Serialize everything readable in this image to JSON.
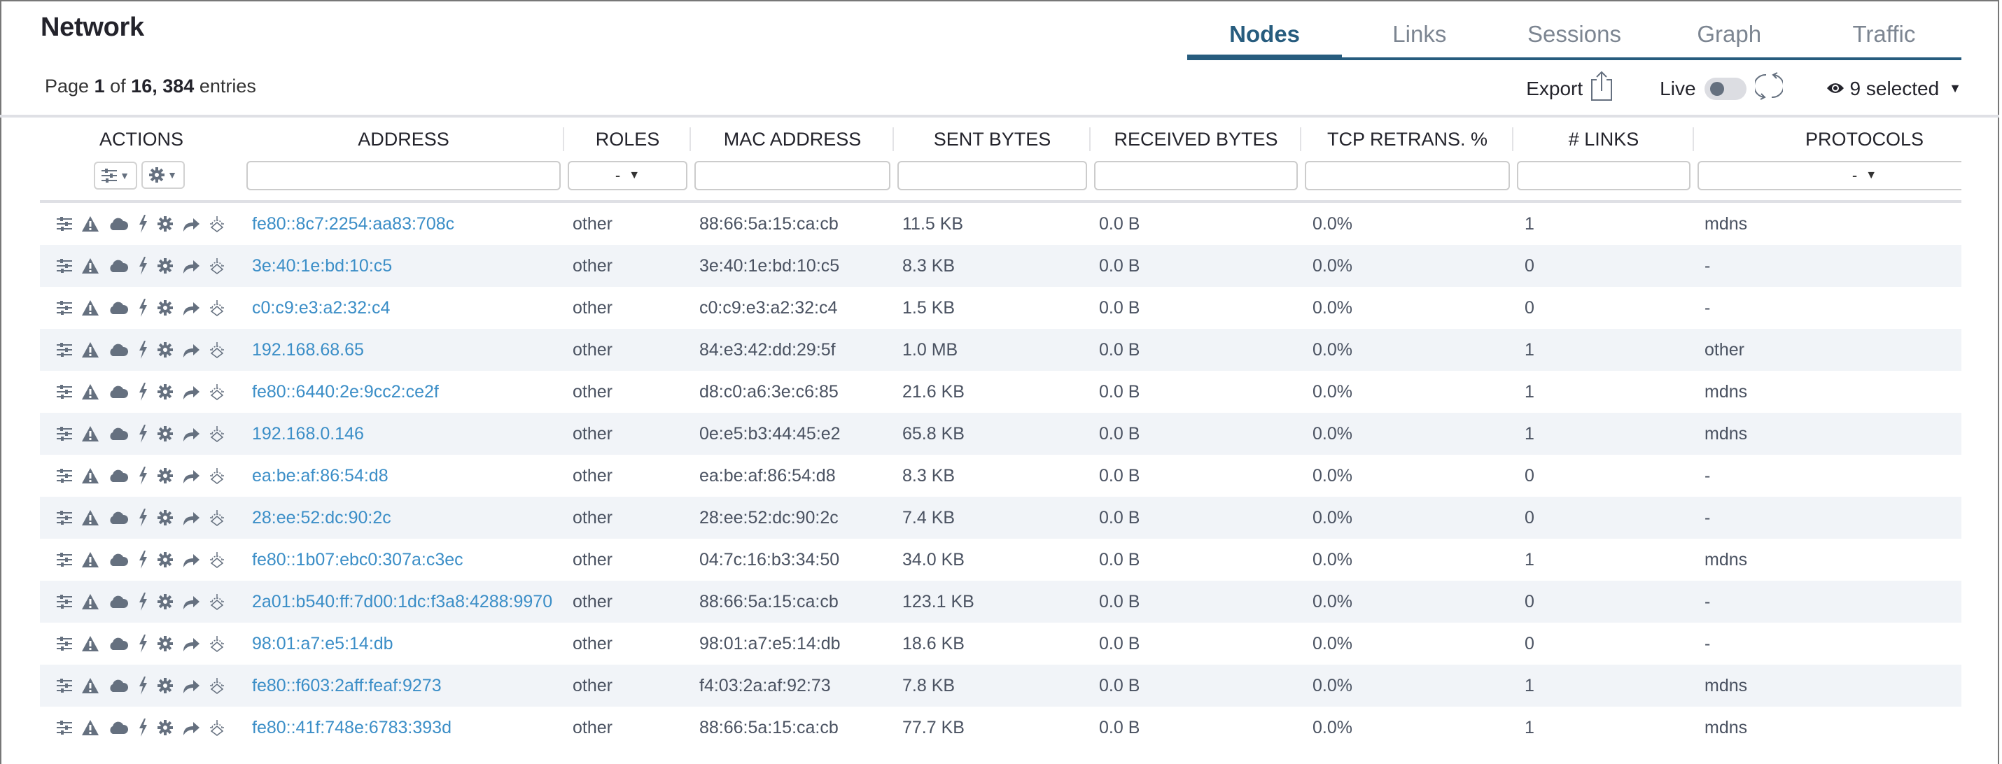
{
  "page": {
    "title": "Network",
    "pagination": {
      "prefix": "Page",
      "current": "1",
      "of_label": "of",
      "pages": "16",
      "count": "384",
      "suffix": "entries"
    }
  },
  "tabs": [
    {
      "label": "Nodes",
      "active": true
    },
    {
      "label": "Links",
      "active": false
    },
    {
      "label": "Sessions",
      "active": false
    },
    {
      "label": "Graph",
      "active": false
    },
    {
      "label": "Traffic",
      "active": false
    }
  ],
  "toolbar": {
    "export_label": "Export",
    "live_label": "Live",
    "live_enabled": false,
    "columns_selected_label": "9 selected"
  },
  "table": {
    "columns": [
      "ACTIONS",
      "ADDRESS",
      "ROLES",
      "MAC ADDRESS",
      "SENT BYTES",
      "RECEIVED BYTES",
      "TCP RETRANS. %",
      "# LINKS",
      "PROTOCOLS"
    ],
    "filters": {
      "roles": "-",
      "protocols": "-"
    },
    "action_icons": [
      "sliders-icon",
      "warning-icon",
      "cloud-icon",
      "bolt-icon",
      "gear-icon",
      "share-icon",
      "crosshair-diamond-icon"
    ],
    "rows": [
      {
        "address": "fe80::8c7:2254:aa83:708c",
        "role": "other",
        "mac": "88:66:5a:15:ca:cb",
        "sent": "11.5 KB",
        "received": "0.0 B",
        "tcp": "0.0%",
        "links": "1",
        "protocols": "mdns"
      },
      {
        "address": "3e:40:1e:bd:10:c5",
        "role": "other",
        "mac": "3e:40:1e:bd:10:c5",
        "sent": "8.3 KB",
        "received": "0.0 B",
        "tcp": "0.0%",
        "links": "0",
        "protocols": "-"
      },
      {
        "address": "c0:c9:e3:a2:32:c4",
        "role": "other",
        "mac": "c0:c9:e3:a2:32:c4",
        "sent": "1.5 KB",
        "received": "0.0 B",
        "tcp": "0.0%",
        "links": "0",
        "protocols": "-"
      },
      {
        "address": "192.168.68.65",
        "role": "other",
        "mac": "84:e3:42:dd:29:5f",
        "sent": "1.0 MB",
        "received": "0.0 B",
        "tcp": "0.0%",
        "links": "1",
        "protocols": "other"
      },
      {
        "address": "fe80::6440:2e:9cc2:ce2f",
        "role": "other",
        "mac": "d8:c0:a6:3e:c6:85",
        "sent": "21.6 KB",
        "received": "0.0 B",
        "tcp": "0.0%",
        "links": "1",
        "protocols": "mdns"
      },
      {
        "address": "192.168.0.146",
        "role": "other",
        "mac": "0e:e5:b3:44:45:e2",
        "sent": "65.8 KB",
        "received": "0.0 B",
        "tcp": "0.0%",
        "links": "1",
        "protocols": "mdns"
      },
      {
        "address": "ea:be:af:86:54:d8",
        "role": "other",
        "mac": "ea:be:af:86:54:d8",
        "sent": "8.3 KB",
        "received": "0.0 B",
        "tcp": "0.0%",
        "links": "0",
        "protocols": "-"
      },
      {
        "address": "28:ee:52:dc:90:2c",
        "role": "other",
        "mac": "28:ee:52:dc:90:2c",
        "sent": "7.4 KB",
        "received": "0.0 B",
        "tcp": "0.0%",
        "links": "0",
        "protocols": "-"
      },
      {
        "address": "fe80::1b07:ebc0:307a:c3ec",
        "role": "other",
        "mac": "04:7c:16:b3:34:50",
        "sent": "34.0 KB",
        "received": "0.0 B",
        "tcp": "0.0%",
        "links": "1",
        "protocols": "mdns"
      },
      {
        "address": "2a01:b540:ff:7d00:1dc:f3a8:4288:9970",
        "role": "other",
        "mac": "88:66:5a:15:ca:cb",
        "sent": "123.1 KB",
        "received": "0.0 B",
        "tcp": "0.0%",
        "links": "0",
        "protocols": "-"
      },
      {
        "address": "98:01:a7:e5:14:db",
        "role": "other",
        "mac": "98:01:a7:e5:14:db",
        "sent": "18.6 KB",
        "received": "0.0 B",
        "tcp": "0.0%",
        "links": "0",
        "protocols": "-"
      },
      {
        "address": "fe80::f603:2aff:feaf:9273",
        "role": "other",
        "mac": "f4:03:2a:af:92:73",
        "sent": "7.8 KB",
        "received": "0.0 B",
        "tcp": "0.0%",
        "links": "1",
        "protocols": "mdns"
      },
      {
        "address": "fe80::41f:748e:6783:393d",
        "role": "other",
        "mac": "88:66:5a:15:ca:cb",
        "sent": "77.7 KB",
        "received": "0.0 B",
        "tcp": "0.0%",
        "links": "1",
        "protocols": "mdns"
      }
    ]
  },
  "colors": {
    "accent": "#275c7e",
    "link": "#3b8ec7",
    "icon": "#65707f",
    "row_alt": "#f1f4f8"
  }
}
